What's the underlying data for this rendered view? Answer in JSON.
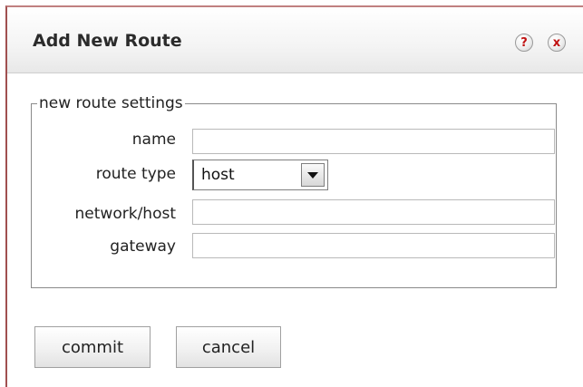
{
  "dialog": {
    "title": "Add New Route",
    "help_icon_glyph": "?",
    "close_icon_glyph": "x",
    "accent_color": "#c01010"
  },
  "settings": {
    "legend": "new route settings",
    "fields": {
      "name": {
        "label": "name",
        "value": ""
      },
      "route_type": {
        "label": "route type",
        "selected": "host"
      },
      "network_host": {
        "label": "network/host",
        "value": ""
      },
      "gateway": {
        "label": "gateway",
        "value": ""
      }
    }
  },
  "actions": {
    "commit_label": "commit",
    "cancel_label": "cancel"
  }
}
